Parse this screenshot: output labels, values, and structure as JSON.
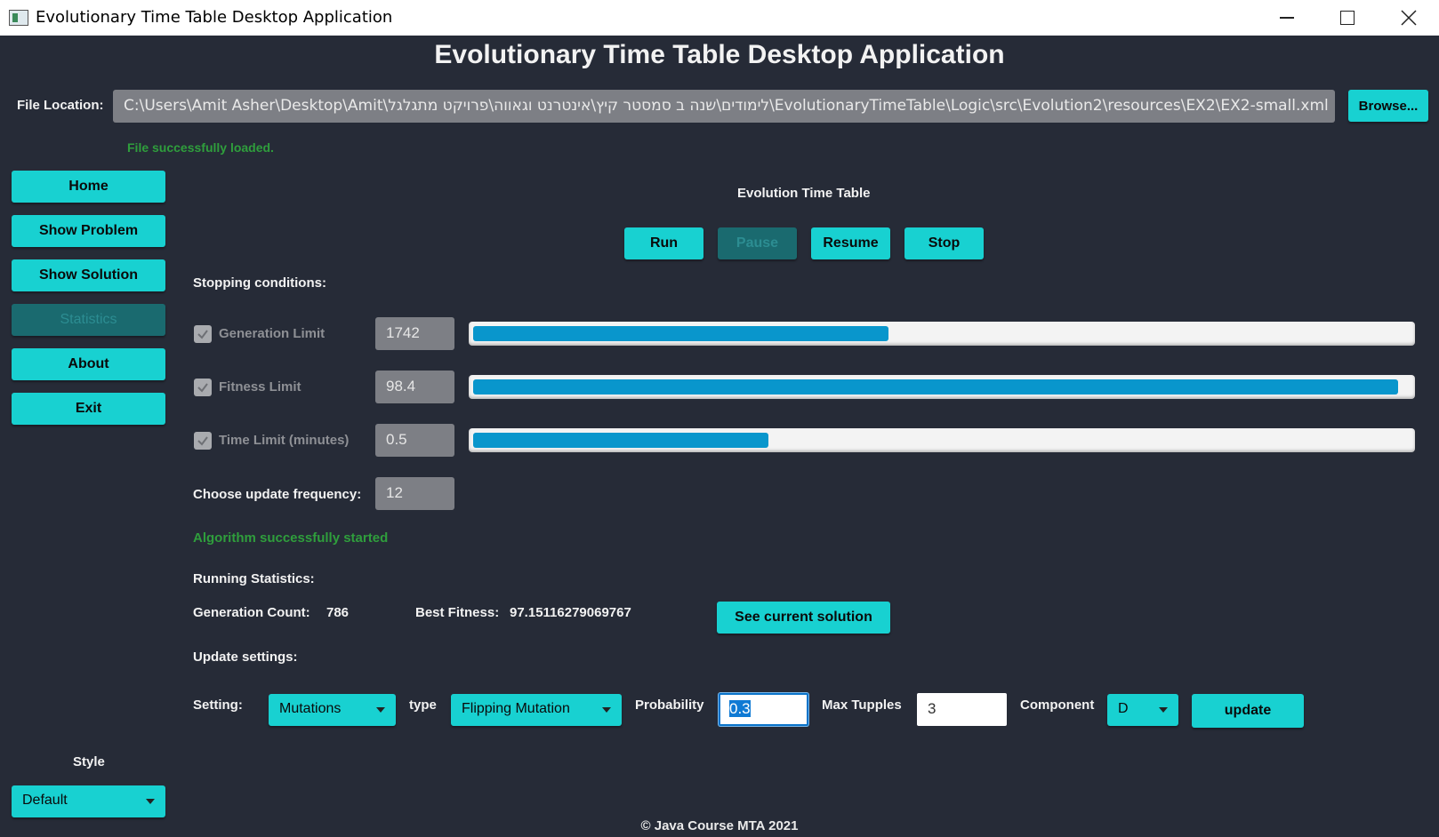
{
  "window": {
    "title": "Evolutionary Time Table Desktop Application"
  },
  "header": {
    "title": "Evolutionary Time Table Desktop Application"
  },
  "file": {
    "label": "File Location:",
    "path": "C:\\Users\\Amit Asher\\Desktop\\Amit\\לימודים\\שנה ב סמסטר קיץ\\אינטרנט וגאווה\\פרויקט מתגלגל\\EvolutionaryTimeTable\\Logic\\src\\Evolution2\\resources\\EX2\\EX2-small.xml",
    "browse_label": "Browse...",
    "status": "File successfully loaded."
  },
  "sidebar": {
    "items": [
      {
        "label": "Home",
        "enabled": true
      },
      {
        "label": "Show Problem",
        "enabled": true
      },
      {
        "label": "Show Solution",
        "enabled": true
      },
      {
        "label": "Statistics",
        "enabled": false
      },
      {
        "label": "About",
        "enabled": true
      },
      {
        "label": "Exit",
        "enabled": true
      }
    ],
    "style_label": "Style",
    "style_value": "Default"
  },
  "main": {
    "section_title": "Evolution Time Table",
    "controls": {
      "run": "Run",
      "pause": "Pause",
      "resume": "Resume",
      "stop": "Stop"
    },
    "stopping_title": "Stopping conditions:",
    "conditions": [
      {
        "label": "Generation Limit",
        "value": "1742",
        "checked": true,
        "progress": 0.443
      },
      {
        "label": "Fitness Limit",
        "value": "98.4",
        "checked": true,
        "progress": 0.987
      },
      {
        "label": "Time Limit (minutes)",
        "value": "0.5",
        "checked": true,
        "progress": 0.315
      }
    ],
    "frequency_label": "Choose update frequency:",
    "frequency_value": "12",
    "algorithm_status": "Algorithm successfully started",
    "running_title": "Running Statistics:",
    "generation_label": "Generation Count:",
    "generation_value": "786",
    "fitness_label": "Best Fitness:",
    "fitness_value": "97.15116279069767",
    "see_solution": "See current solution",
    "update_title": "Update settings:",
    "setting_label": "Setting:",
    "setting_value": "Mutations",
    "type_label": "type",
    "type_value": "Flipping Mutation",
    "probability_label": "Probability",
    "probability_value": "0.3",
    "max_tupples_label": "Max Tupples",
    "max_tupples_value": "3",
    "component_label": "Component",
    "component_value": "D",
    "update_button": "update"
  },
  "footer": {
    "text": "© Java Course MTA 2021"
  },
  "colors": {
    "background": "#262b37",
    "accent": "#18d1d1",
    "progress": "#0996cc",
    "success": "#2f9e3c"
  }
}
